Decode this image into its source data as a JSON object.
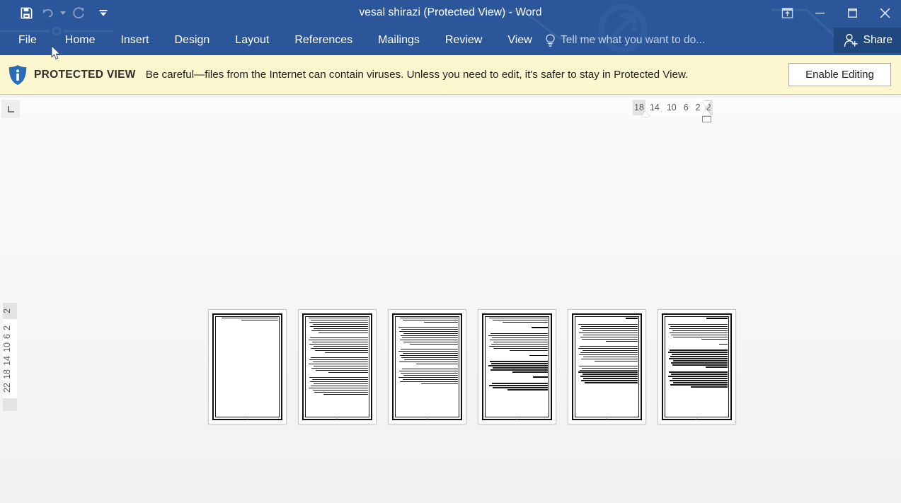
{
  "window": {
    "title": "vesal shirazi (Protected View) - Word",
    "app_accent": "#2b579a",
    "controls": {
      "ribbon_display_options": "Ribbon Display Options",
      "minimize": "Minimize",
      "maximize": "Restore Down",
      "close": "Close"
    }
  },
  "quick_access": {
    "items": [
      {
        "name": "save-icon",
        "label": "Save",
        "enabled": true
      },
      {
        "name": "undo-icon",
        "label": "Undo",
        "enabled": false
      },
      {
        "name": "redo-icon",
        "label": "Repeat",
        "enabled": false
      }
    ],
    "customize_label": "Customize Quick Access Toolbar"
  },
  "ribbon": {
    "tabs": [
      {
        "label": "File"
      },
      {
        "label": "Home"
      },
      {
        "label": "Insert"
      },
      {
        "label": "Design"
      },
      {
        "label": "Layout"
      },
      {
        "label": "References"
      },
      {
        "label": "Mailings"
      },
      {
        "label": "Review"
      },
      {
        "label": "View"
      }
    ],
    "tellme_placeholder": "Tell me what you want to do...",
    "share_label": "Share"
  },
  "protected_view": {
    "badge": "PROTECTED VIEW",
    "message": "Be careful—files from the Internet can contain viruses. Unless you need to edit, it's safer to stay in Protected View.",
    "enable_button": "Enable Editing",
    "bar_color": "#fdf7cf",
    "shield_color": "#2b6cb8"
  },
  "rulers": {
    "tab_stop_selector": "Left Tab",
    "horizontal": {
      "orientation": "rtl",
      "ticks": [
        "18",
        "14",
        "10",
        "6",
        "2",
        "2"
      ]
    },
    "vertical": {
      "ticks": [
        "2",
        "2",
        "6",
        "10",
        "14",
        "18",
        "22"
      ]
    }
  },
  "document": {
    "zoom_view": "multiple-pages",
    "page_count": 6,
    "text_direction": "rtl",
    "pages": [
      {
        "number": "1",
        "kind": "title-page",
        "blocks": [
          {
            "type": "para",
            "lines": [
              92,
              60
            ]
          }
        ]
      },
      {
        "number": "2",
        "kind": "body",
        "blocks": [
          {
            "type": "para",
            "lines": [
              96,
              93,
              95,
              90,
              94,
              88,
              92,
              80
            ]
          },
          {
            "type": "para",
            "lines": [
              94,
              96,
              91,
              95,
              89,
              93,
              86,
              70
            ]
          },
          {
            "type": "para",
            "lines": [
              93,
              95,
              90,
              96,
              88,
              92,
              85,
              64
            ]
          },
          {
            "type": "para",
            "lines": [
              95,
              91,
              94,
              89,
              93,
              96,
              90,
              87,
              72
            ]
          }
        ]
      },
      {
        "number": "3",
        "kind": "body",
        "blocks": [
          {
            "type": "para",
            "lines": [
              94,
              90,
              55
            ]
          },
          {
            "type": "para",
            "lines": [
              96,
              92,
              95,
              89,
              93,
              91,
              94,
              88,
              78
            ]
          },
          {
            "type": "para",
            "lines": [
              93,
              96,
              90,
              94,
              92,
              87,
              95,
              68
            ]
          },
          {
            "type": "para",
            "lines": [
              91,
              95,
              93,
              89,
              96,
              90,
              94,
              60
            ]
          }
        ]
      },
      {
        "number": "4",
        "kind": "body",
        "blocks": [
          {
            "type": "para",
            "lines": [
              95,
              90,
              74
            ]
          },
          {
            "type": "head",
            "lines": [
              26
            ]
          },
          {
            "type": "para",
            "lines": [
              93,
              96,
              91,
              94,
              89,
              92,
              95,
              88,
              62
            ]
          },
          {
            "type": "head",
            "lines": [
              30
            ]
          },
          {
            "type": "para",
            "lines": [
              94,
              92,
              96,
              90,
              93,
              58
            ]
          },
          {
            "type": "head",
            "lines": [
              24
            ]
          },
          {
            "type": "para",
            "lines": [
              91,
              95,
              90,
              66
            ]
          }
        ]
      },
      {
        "number": "5",
        "kind": "body",
        "blocks": [
          {
            "type": "head",
            "lines": [
              20
            ]
          },
          {
            "type": "para",
            "lines": [
              96,
              92,
              94,
              90,
              95,
              88,
              93,
              91,
              52
            ]
          },
          {
            "type": "para",
            "lines": [
              94,
              96,
              90,
              93,
              95,
              89,
              92,
              70
            ]
          },
          {
            "type": "para",
            "lines": [
              95,
              91,
              94,
              96,
              90,
              93,
              88,
              92,
              86
            ]
          }
        ]
      },
      {
        "number": "6",
        "kind": "body",
        "blocks": [
          {
            "type": "head",
            "lines": [
              34
            ]
          },
          {
            "type": "para",
            "lines": [
              96,
              93,
              95,
              90,
              94,
              92,
              88,
              42
            ]
          },
          {
            "type": "head",
            "lines": [
              14
            ]
          },
          {
            "type": "para",
            "lines": [
              94,
              96,
              91,
              93,
              95,
              89,
              92,
              90,
              36
            ]
          },
          {
            "type": "para",
            "lines": [
              95,
              92,
              96,
              90,
              94,
              88,
              93,
              60
            ]
          }
        ]
      }
    ]
  }
}
